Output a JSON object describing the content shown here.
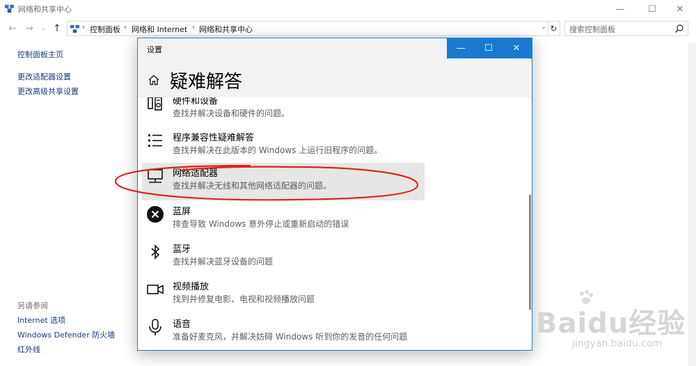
{
  "cp_window": {
    "title": "网络和共享中心",
    "controls": {
      "minimize": "—",
      "maximize": "☐",
      "close": "✕"
    }
  },
  "address_bar": {
    "crumbs": [
      "控制面板",
      "网络和 Internet",
      "网络和共享中心"
    ],
    "search_placeholder": "搜索控制面板"
  },
  "left_nav": {
    "home": "控制面板主页",
    "links": [
      "更改适配器设置",
      "更改高级共享设置"
    ],
    "see_also_title": "另请参阅",
    "see_also": [
      "Internet 选项",
      "Windows Defender 防火墙",
      "红外线"
    ]
  },
  "settings_dialog": {
    "title": "设置",
    "heading": "疑难解答",
    "controls": {
      "minimize": "—",
      "maximize": "☐",
      "close": "✕"
    },
    "items": [
      {
        "title": "硬件和设备",
        "desc": "查找并解决设备和硬件的问题。",
        "icon": "hardware-icon"
      },
      {
        "title": "程序兼容性疑难解答",
        "desc": "查找并解决在此版本的 Windows 上运行旧程序的问题。",
        "icon": "list-icon"
      },
      {
        "title": "网络适配器",
        "desc": "查找并解决无线和其他网络适配器的问题。",
        "icon": "network-adapter-icon"
      },
      {
        "title": "蓝屏",
        "desc": "排查导致 Windows 意外停止或重新启动的错误",
        "icon": "bluescreen-x-icon"
      },
      {
        "title": "蓝牙",
        "desc": "查找并解决蓝牙设备的问题",
        "icon": "bluetooth-icon"
      },
      {
        "title": "视频播放",
        "desc": "找到并修复电影、电视和视频播放问题",
        "icon": "video-icon"
      },
      {
        "title": "语音",
        "desc": "准备好麦克风，并解决妨碍 Windows 听到你的发音的任何问题",
        "icon": "microphone-icon"
      }
    ]
  },
  "watermark": {
    "logo": "Baidu经验",
    "url": "jingyan.baidu.com"
  },
  "colors": {
    "accent": "#1a7ad1",
    "link": "#1a3b7a",
    "highlight_row": "#e6e6e6",
    "annotation": "#e0201c"
  }
}
